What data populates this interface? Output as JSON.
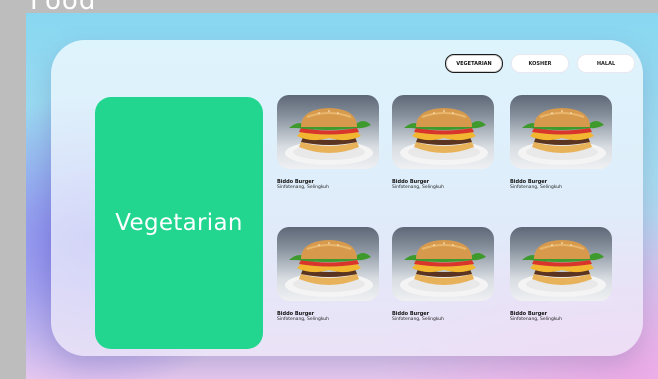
{
  "frame": {
    "title": "Food"
  },
  "filters": [
    {
      "label": "VEGETARIAN",
      "active": true
    },
    {
      "label": "KOSHER",
      "active": false
    },
    {
      "label": "HALAL",
      "active": false
    }
  ],
  "category": {
    "label": "Vegetarian",
    "color": "#22d690"
  },
  "items": [
    {
      "name": "Biddo Burger",
      "desc": "Sinfotenang, Selingkuh"
    },
    {
      "name": "Biddo Burger",
      "desc": "Sinfotenang, Selingkuh"
    },
    {
      "name": "Biddo Burger",
      "desc": "Sinfotenang, Selingkuh"
    },
    {
      "name": "Biddo Burger",
      "desc": "Sinfotenang, Selingkuh"
    },
    {
      "name": "Biddo Burger",
      "desc": "Sinfotenang, Selingkuh"
    },
    {
      "name": "Biddo Burger",
      "desc": "Sinfotenang, Selingkuh"
    }
  ]
}
